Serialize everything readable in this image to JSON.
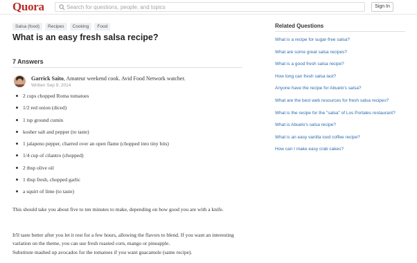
{
  "header": {
    "logo": "Quora",
    "search_placeholder": "Search for questions, people, and topics",
    "signin_label": "Sign In"
  },
  "question": {
    "topics": [
      "Salsa (food)",
      "Recipes",
      "Cooking",
      "Food"
    ],
    "title": "What is an easy fresh salsa recipe?"
  },
  "answers": {
    "count_label": "7 Answers"
  },
  "answer": {
    "author_name": "Garrick Saito",
    "author_bio": ", Amateur weekend cook. Avid Food Network watcher.",
    "written": "Written Sep 9, 2014",
    "ingredients": [
      "2 cups chopped Roma tomatoes",
      "1/2 red onion (diced)",
      "1 tsp ground cumin",
      "kosher salt and pepper (to taste)",
      "1 jalapeno pepper, charred over an open flame (chopped into tiny bits)",
      "1/4 cup of cilantro (chopped)",
      "2 tbsp olive oil",
      "1 tbsp fresh, chopped garlic",
      "a squirt of lime (to taste)"
    ],
    "paragraphs": [
      "This should take you about five to ten minutes to make, depending on how good you are with a knife.",
      "It'll taste better after you let it rest for a few hours, allowing the flavors to blend.  If you want an interesting variation on the theme, you can use fresh roasted corn, mango or pineapple.",
      "Substitute mashed up avocados for the tomatoes if you want guacamole (same recipe)."
    ]
  },
  "sidebar": {
    "title": "Related Questions",
    "questions": [
      "What is a recipe for sugar-free salsa?",
      "What are some great salsa recipes?",
      "What is a good fresh salsa recipe?",
      "How long can fresh salsa last?",
      "Anyone have the recipe for Abuelo's salsa?",
      "What are the best web resources for fresh salsa recipes?",
      "What is the recipe for the \"salsa\" of Los Portales restaurant?",
      "What is Abuelo's salsa recipe?",
      "What is an easy vanilla iced coffee recipe?",
      "How can I make easy crab cakes?"
    ]
  },
  "colors": {
    "brand": "#b92b27",
    "link": "#2b6dad"
  },
  "icons": {
    "search": "search-icon"
  }
}
